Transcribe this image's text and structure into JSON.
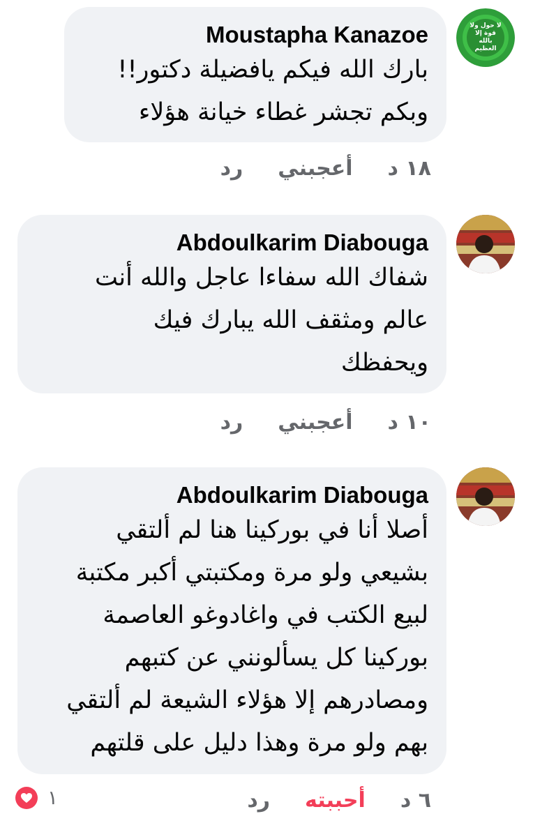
{
  "comments": [
    {
      "author": "Moustapha Kanazoe",
      "text": "بارك الله فيكم يافضيلة دكتور!!\nوبكم تجشر غطاء خيانة هؤلاء",
      "time": "١٨ د",
      "like_label": "أعجبني",
      "reply_label": "رد",
      "avatar_text": "لا حول ولا قوة إلا بالله العظيم"
    },
    {
      "author": "Abdoulkarim Diabouga",
      "text": "شفاك الله سفاءا عاجل والله أنت\nعالم ومثقف الله يبارك فيك\nويحفظك",
      "time": "١٠ د",
      "like_label": "أعجبني",
      "reply_label": "رد"
    },
    {
      "author": "Abdoulkarim Diabouga",
      "text": "أصلا أنا في بوركينا هنا لم ألتقي\nبشيعي ولو مرة ومكتبتي أكبر مكتبة\nلبيع الكتب في واغادوغو العاصمة\nبوركينا كل يسألونني عن كتبهم\nومصادرهم إلا هؤلاء الشيعة لم ألتقي\nبهم ولو مرة وهذا دليل على قلتهم",
      "time": "٦ د",
      "like_label": "أحببته",
      "reply_label": "رد",
      "reaction_count": "١"
    }
  ],
  "colors": {
    "bubble": "#f0f2f5",
    "meta": "#65676b",
    "love": "#f33e58",
    "avatar_green": "#2e9e3a"
  },
  "icons": {
    "reaction": "heart-icon"
  }
}
